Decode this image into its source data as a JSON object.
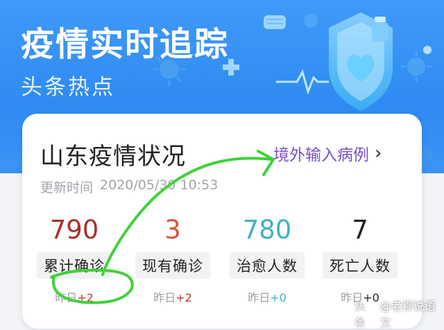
{
  "colors": {
    "hero_bg": "#3a95f6",
    "confirmed_total": "#a8302b",
    "current_confirmed": "#d9533a",
    "recovered": "#3fb2c0",
    "deaths": "#222222",
    "delta_red": "#c0392b",
    "delta_teal": "#3fb2c0",
    "annotation_green": "#3fd13a",
    "link_purple": "#7b4fc9"
  },
  "hero": {
    "title": "疫情实时追踪",
    "subtitle": "头条热点",
    "icons": [
      "shield-heart-icon",
      "virus-icon",
      "mask-icon",
      "medicine-bottle-icon",
      "medical-cross-icon"
    ]
  },
  "card": {
    "title": "山东疫情状况",
    "link_label": "境外输入病例",
    "updated_label": "更新时间",
    "updated_time": "2020/05/30 10:53",
    "stats": [
      {
        "value": "790",
        "label": "累计确诊",
        "delta_prefix": "昨日",
        "delta": "+2",
        "color": "#a8302b",
        "delta_color": "#c0392b"
      },
      {
        "value": "3",
        "label": "现有确诊",
        "delta_prefix": "昨日",
        "delta": "+2",
        "color": "#d9533a",
        "delta_color": "#c0392b"
      },
      {
        "value": "780",
        "label": "治愈人数",
        "delta_prefix": "昨日",
        "delta": "+0",
        "color": "#3fb2c0",
        "delta_color": "#3fb2c0"
      },
      {
        "value": "7",
        "label": "死亡人数",
        "delta_prefix": "昨日",
        "delta": "+0",
        "color": "#222222",
        "delta_color": "#222222"
      }
    ]
  },
  "watermark": {
    "platform": "头条",
    "handle": "@老穆说语文"
  }
}
